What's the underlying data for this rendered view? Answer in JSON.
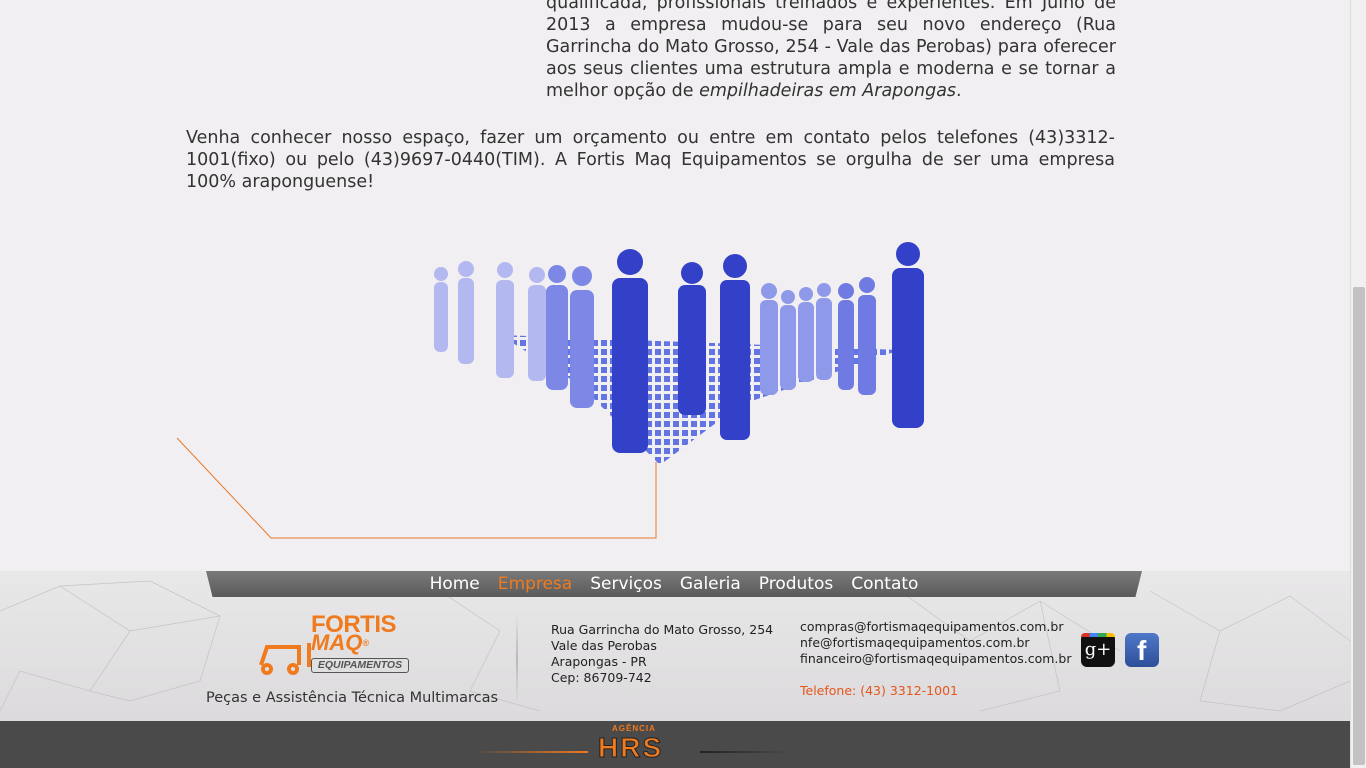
{
  "content": {
    "para1_a": "qualificada, profissionais treinados e experientes. Em Julho de 2013 a empresa mudou-se para seu novo endereço (Rua Garrincha do Mato Grosso, 254 - Vale das Perobas) para oferecer aos seus clientes uma estrutura ampla e moderna e se tornar a melhor opção de ",
    "para1_em": "empilhadeiras em Arapongas",
    "para1_b": ".",
    "para2": "Venha conhecer nosso espaço, fazer um orçamento ou entre em contato pelos telefones (43)3312-1001(fixo) ou pelo (43)9697-0440(TIM). A Fortis Maq Equipamentos se orgulha de ser uma empresa 100% araponguense!"
  },
  "nav": {
    "items": [
      "Home",
      "Empresa",
      "Serviços",
      "Galeria",
      "Produtos",
      "Contato"
    ],
    "active": "Empresa",
    "active_color": "#f07a1e"
  },
  "footer": {
    "logo": {
      "line1": "FORTIS",
      "line2": "MAQ",
      "line3": "EQUIPAMENTOS",
      "reg": "®"
    },
    "tagline": "Peças e Assistência Técnica Multimarcas",
    "address": [
      "Rua Garrincha do Mato Grosso, 254",
      "Vale das Perobas",
      "Arapongas - PR",
      "Cep: 86709-742"
    ],
    "emails": [
      "compras@fortismaqequipamentos.com.br",
      "nfe@fortismaqequipamentos.com.br",
      "financeiro@fortismaqequipamentos.com.br"
    ],
    "phone": "Telefone: (43) 3312-1001",
    "social": {
      "gplus": "g+",
      "facebook": "f"
    }
  },
  "agency": {
    "label": "AGÊNCIA",
    "name": "HRS"
  },
  "colors": {
    "accent": "#f07a1e",
    "phone": "#e4561b",
    "people": "#3a4fd0"
  }
}
